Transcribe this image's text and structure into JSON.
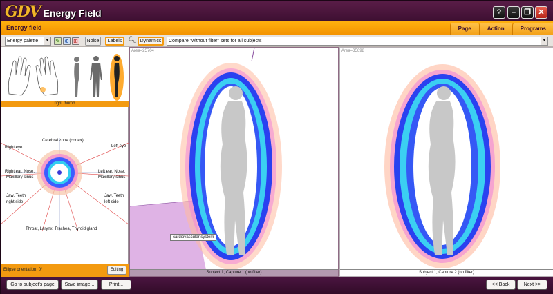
{
  "window": {
    "brand_gdv": "GDV",
    "brand_rest": "Energy Field",
    "buttons": {
      "help": "?",
      "minimize": "–",
      "restore": "❐",
      "close": "✕"
    }
  },
  "header": {
    "title": "Energy field",
    "menu": [
      {
        "label": "Page"
      },
      {
        "label": "Action"
      },
      {
        "label": "Programs"
      }
    ]
  },
  "toolbar": {
    "palette_select": "Energy palette",
    "noise_label": "Noise",
    "labels_label": "Labels",
    "dynamics_label": "Dynamics",
    "compare_select": "Compare \"without filter\" sets for all subjects"
  },
  "left_panel": {
    "finger_label": "right thumb",
    "sectors": {
      "cerebral": "Cerebral zone (cortex)",
      "right_eye": "Right eye",
      "left_eye": "Left eye",
      "right_ear": "Right ear, Nose,",
      "right_ear_2": "Maxillary sinus",
      "left_ear": "Left ear, Nose,",
      "left_ear_2": "Maxillary sinus",
      "jaw_right": "Jaw, Teeth",
      "jaw_right_2": "right side",
      "jaw_left": "Jaw, Teeth",
      "jaw_left_2": "left side",
      "throat": "Throat, Larynx, Trachea, Thyroid gland"
    },
    "orientation": "Ellipse orientation: 0°",
    "editing_label": "Editing"
  },
  "panels": [
    {
      "area": "Area=25704",
      "caption": "Subject 1, Capture 1 (no filter)",
      "tooltip": "cardiovascular system"
    },
    {
      "area": "Area=35698",
      "caption": "Subject 1, Capture 2 (no filter)"
    }
  ],
  "bottom": {
    "go_subject": "Go to subject's page",
    "save_image": "Save image...",
    "print": "Print...",
    "back": "<< Back",
    "next": "Next >>"
  },
  "colors": {
    "accent": "#f39a10",
    "frame": "#3b1030",
    "aura_inner": "#1a3cff",
    "aura_mid": "#39d0f0",
    "aura_outer": "#ff9a6a"
  }
}
